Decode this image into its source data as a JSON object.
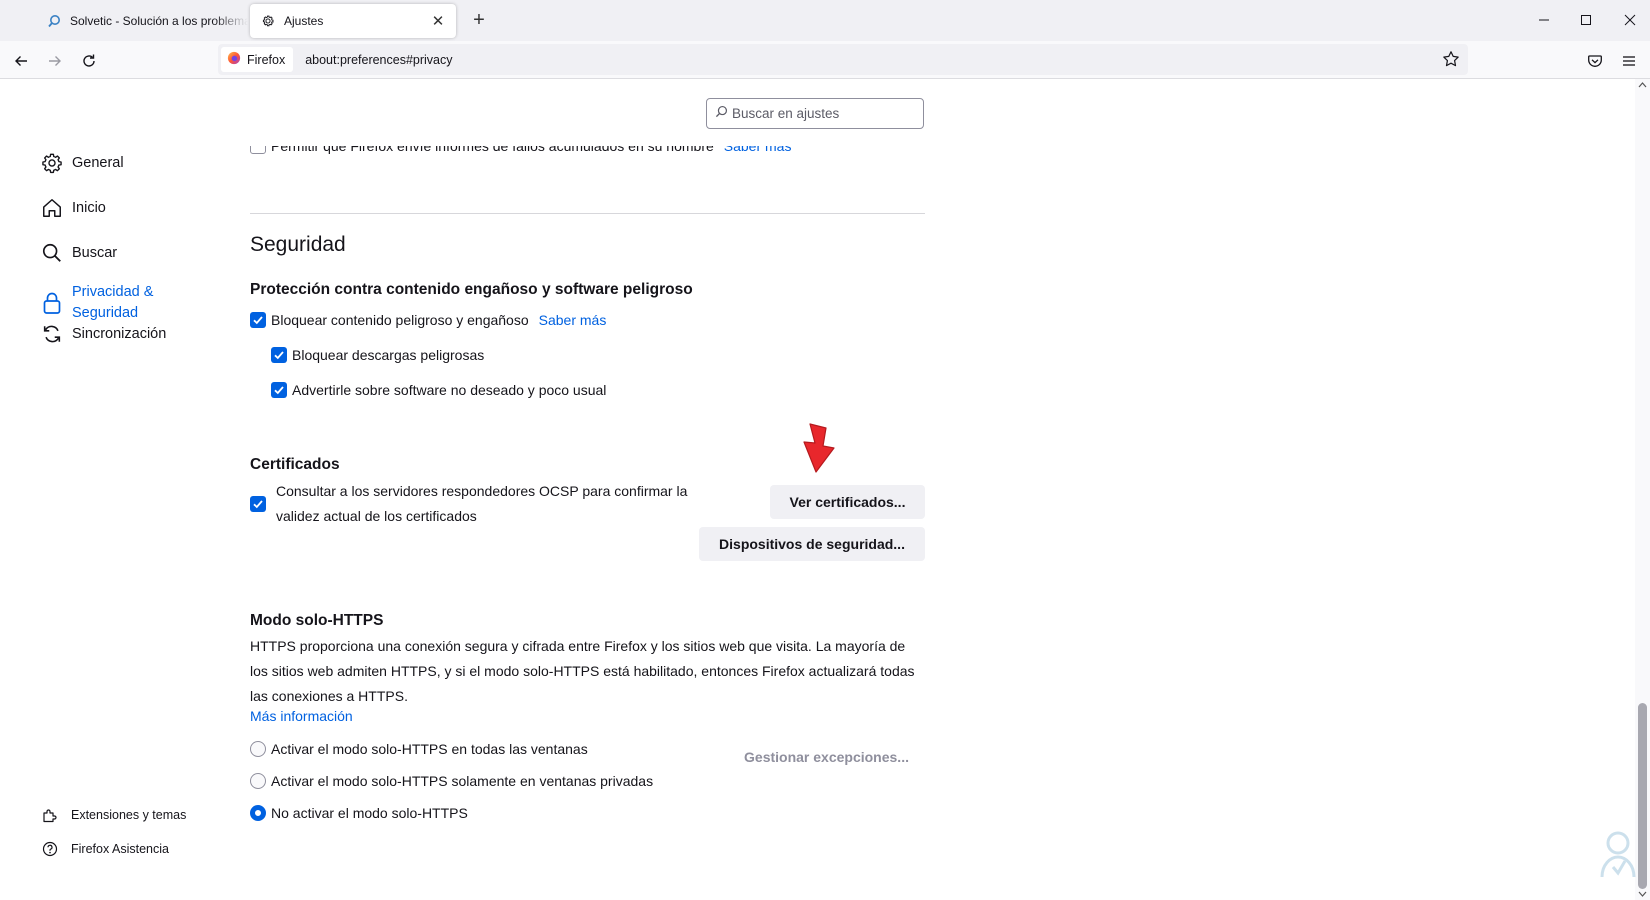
{
  "tabs": [
    {
      "label": "Solvetic - Solución a los problemas",
      "icon": "search-icon",
      "active": false
    },
    {
      "label": "Ajustes",
      "icon": "gear-icon",
      "active": true
    }
  ],
  "toolbar": {
    "identity_label": "Firefox",
    "url": "about:preferences#privacy"
  },
  "search": {
    "placeholder": "Buscar en ajustes"
  },
  "sidebar": {
    "items": [
      {
        "label": "General",
        "icon": "gear-icon"
      },
      {
        "label": "Inicio",
        "icon": "home-icon"
      },
      {
        "label": "Buscar",
        "icon": "search-icon"
      },
      {
        "label": "Privacidad &",
        "label2": "Seguridad",
        "icon": "lock-icon",
        "active": true
      },
      {
        "label": "Sincronización",
        "icon": "sync-icon"
      }
    ],
    "footer": [
      {
        "label": "Extensiones y temas",
        "icon": "puzzle-icon"
      },
      {
        "label": "Firefox Asistencia",
        "icon": "help-icon"
      }
    ]
  },
  "partial_row": {
    "text": "Permitir que Firefox envíe informes de fallos acumulados en su nombre",
    "link": "Saber más"
  },
  "security": {
    "heading": "Seguridad",
    "deceptive": {
      "heading": "Protección contra contenido engañoso y software peligroso",
      "block_dangerous": "Bloquear contenido peligroso y engañoso",
      "learn_more": "Saber más",
      "block_downloads": "Bloquear descargas peligrosas",
      "warn_unwanted": "Advertirle sobre software no deseado y poco usual"
    },
    "certificates": {
      "heading": "Certificados",
      "ocsp_line1": "Consultar a los servidores respondedores OCSP para confirmar la",
      "ocsp_line2": "validez actual de los certificados",
      "view_button": "Ver certificados...",
      "devices_button": "Dispositivos de seguridad..."
    },
    "https_only": {
      "heading": "Modo solo-HTTPS",
      "description": "HTTPS proporciona una conexión segura y cifrada entre Firefox y los sitios web que visita. La mayoría de los sitios web admiten HTTPS, y si el modo solo-HTTPS está habilitado, entonces Firefox actualizará todas las conexiones a HTTPS.",
      "more_info": "Más información",
      "options": [
        {
          "label": "Activar el modo solo-HTTPS en todas las ventanas",
          "selected": false
        },
        {
          "label": "Activar el modo solo-HTTPS solamente en ventanas privadas",
          "selected": false
        },
        {
          "label": "No activar el modo solo-HTTPS",
          "selected": true
        }
      ],
      "exceptions_button": "Gestionar excepciones..."
    }
  },
  "colors": {
    "accent": "#0061e0",
    "arrow": "#e8272c"
  }
}
